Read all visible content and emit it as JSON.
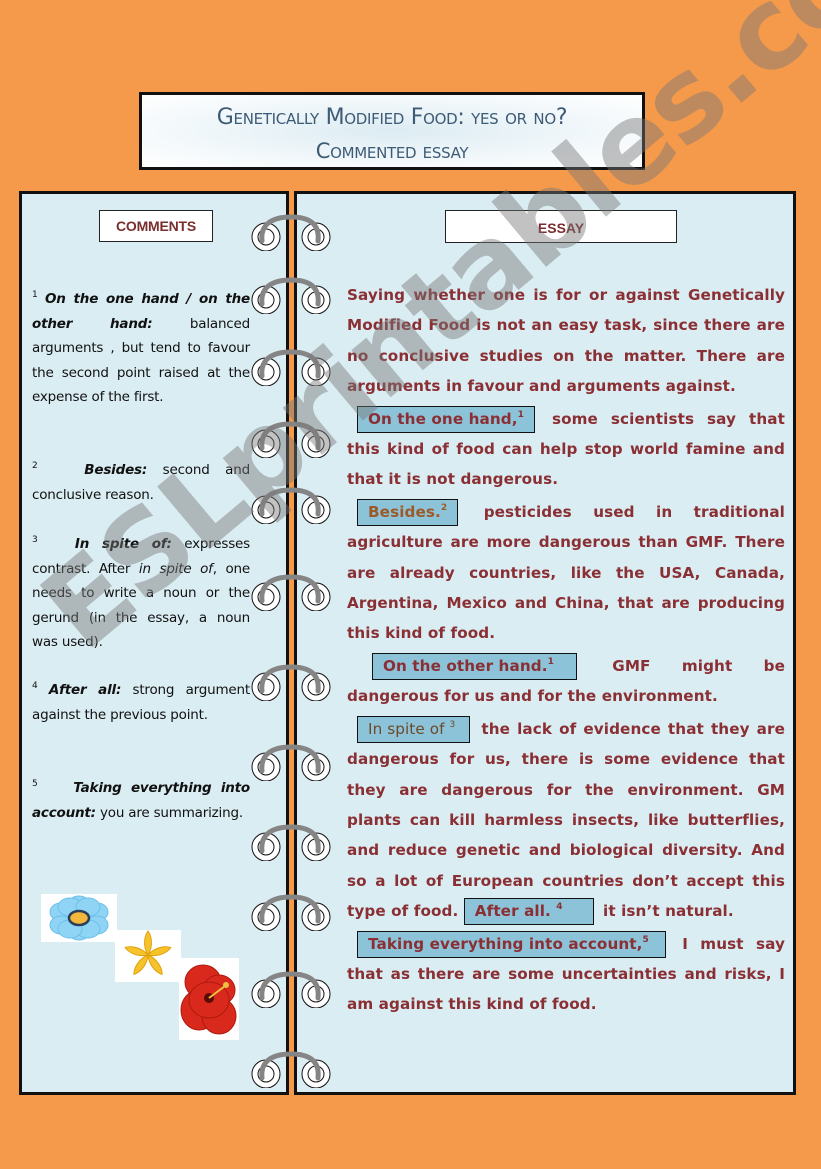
{
  "title": {
    "line1": "Genetically Modified Food: yes or no?",
    "line2": "Commented essay"
  },
  "comments": {
    "header": "COMMENTS",
    "items": [
      {
        "num": "1",
        "key": "On the one hand / on the other hand:",
        "text": " balanced arguments , but tend to favour the second point raised at the expense of the first."
      },
      {
        "num": "2",
        "key": "Besides:",
        "text": " second and conclusive reason."
      },
      {
        "num": "3",
        "key": "In spite of:",
        "text_before": " expresses contrast. After ",
        "em": "in spite of",
        "text_after": ", one needs to write a noun or the gerund (in the essay, a noun was used)."
      },
      {
        "num": "4",
        "key": "After all:",
        "text": " strong argument against the previous point."
      },
      {
        "num": "5",
        "key": "Taking everything into account:",
        "text": " you are summarizing."
      }
    ]
  },
  "essay": {
    "header": "ESSAY",
    "intro": "Saying whether one is for or against Genetically Modified Food is not an easy task, since there are no conclusive studies on the matter. There are arguments in favour and arguments against.",
    "p1": {
      "chip": "On the one hand,",
      "sup": "1",
      "text": " some scientists say that this kind of food can help stop world famine and that it is not dangerous."
    },
    "p2": {
      "chip": "Besides.",
      "sup": "2",
      "text": " pesticides used in traditional agriculture are more dangerous than GMF. There are already countries, like the USA, Canada, Argentina, Mexico and China, that are producing this kind of food."
    },
    "p3": {
      "chip": "On the other hand.",
      "sup": "1",
      "text": " GMF might be dangerous for us and for the environment."
    },
    "p4": {
      "chip": "In spite of",
      "sup": "3",
      "text": " the lack of evidence that they are dangerous for us, there is some evidence that they are dangerous for the environment. GM plants can kill harmless insects, like butterflies, and reduce genetic and biological diversity. And so a lot of European countries don’t accept this type of food. ",
      "chip2": "After all.",
      "sup2": "4",
      "text2": " it isn’t natural."
    },
    "p5": {
      "chip": "Taking everything into account,",
      "sup": "5",
      "text": " I must say that as there are some uncertainties and risks, I am against this kind of food."
    }
  },
  "decor": {
    "watermark": "ESLprintables.com",
    "flowers": [
      "blue-flower",
      "yellow-flower",
      "red-hibiscus"
    ],
    "ring_count": 12
  },
  "colors": {
    "background": "#f59a4a",
    "panel": "#daedf3",
    "essay_text": "#8a2f33",
    "chip": "#8dc3d8",
    "title_text": "#3e5b76"
  }
}
